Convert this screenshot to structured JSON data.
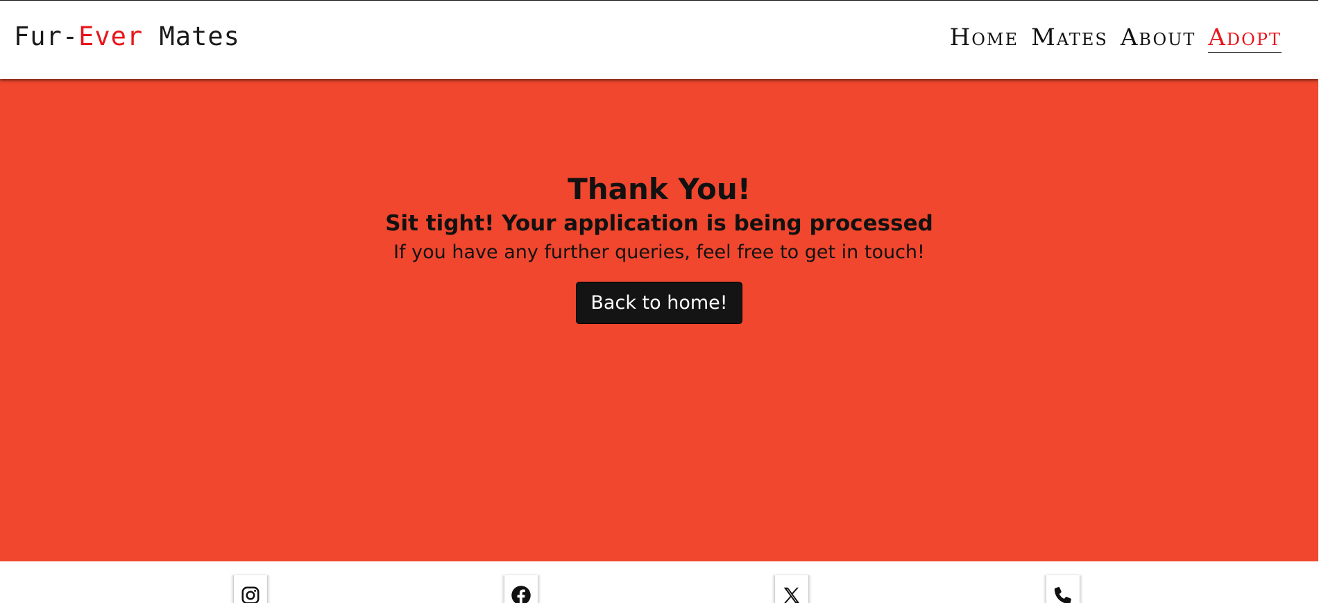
{
  "brand": {
    "prefix": "Fur-",
    "highlight": "Ever",
    "suffix": " Mates"
  },
  "nav": {
    "items": [
      {
        "label": "Home",
        "active": false
      },
      {
        "label": "Mates",
        "active": false
      },
      {
        "label": "About",
        "active": false
      },
      {
        "label": "Adopt",
        "active": true
      }
    ]
  },
  "hero": {
    "title": "Thank You!",
    "subtitle": "Sit tight! Your application is being processed",
    "message": "If you have any further queries, feel free to get in touch!",
    "button_label": "Back to home!"
  },
  "footer": {
    "icons": [
      "instagram-icon",
      "facebook-icon",
      "x-icon",
      "phone-icon"
    ]
  },
  "colors": {
    "hero_background": "#f0472e",
    "brand_accent": "#e8151b",
    "button_background": "#141414"
  }
}
